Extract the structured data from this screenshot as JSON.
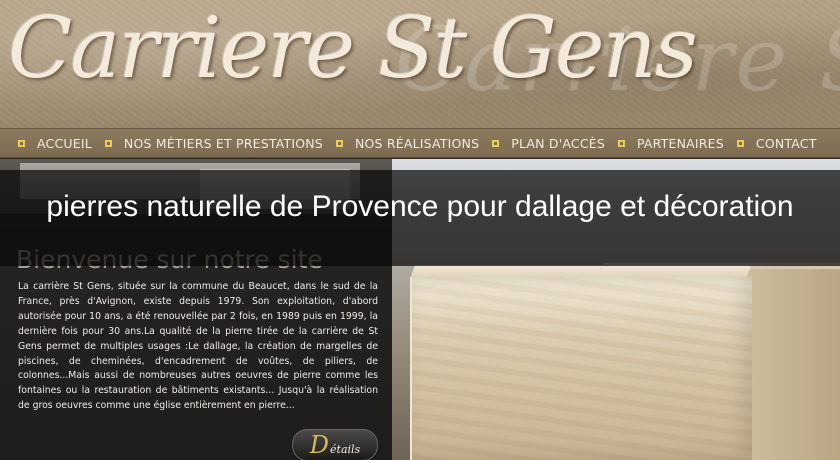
{
  "header": {
    "logo_text": "Carriere St Gens",
    "background_script": "Carriere St Gens"
  },
  "nav": {
    "items": [
      {
        "label": "ACCUEIL"
      },
      {
        "label": "NOS MÉTIERS ET PRESTATIONS"
      },
      {
        "label": "NOS RÉALISATIONS"
      },
      {
        "label": "PLAN D'ACCÈS"
      },
      {
        "label": "PARTENAIRES"
      },
      {
        "label": "CONTACT"
      }
    ]
  },
  "overlay": {
    "title": "pierres naturelle de Provence pour dallage et décoration"
  },
  "main": {
    "welcome_heading": "Bienvenue sur notre site",
    "paragraph": "La carrière St Gens, située sur la commune du Beaucet, dans le sud de la France, près d'Avignon, existe depuis 1979. Son exploitation, d'abord autorisée pour 10 ans, a été renouvellée par 2 fois, en 1989 puis en 1999, la dernière fois pour 30 ans.La qualité de la pierre tirée de la carrière de St Gens permet de multiples usages :Le dallage, la création de margelles de piscines, de cheminées, d'encadrement de voûtes, de piliers, de colonnes...Mais aussi de nombreuses autres oeuvres de pierre comme les fontaines ou la restauration de bâtiments existants... Jusqu'à la réalisation de gros oeuvres comme une église entièrement en pierre...",
    "details_button": {
      "initial": "D",
      "rest": "étails"
    }
  },
  "colors": {
    "nav_bullet": "#e9cf53",
    "nav_bar": "#7e6c52",
    "accent_gold": "#d7b95a"
  },
  "icons": {
    "nav_bullet": "square-bullet-icon"
  }
}
